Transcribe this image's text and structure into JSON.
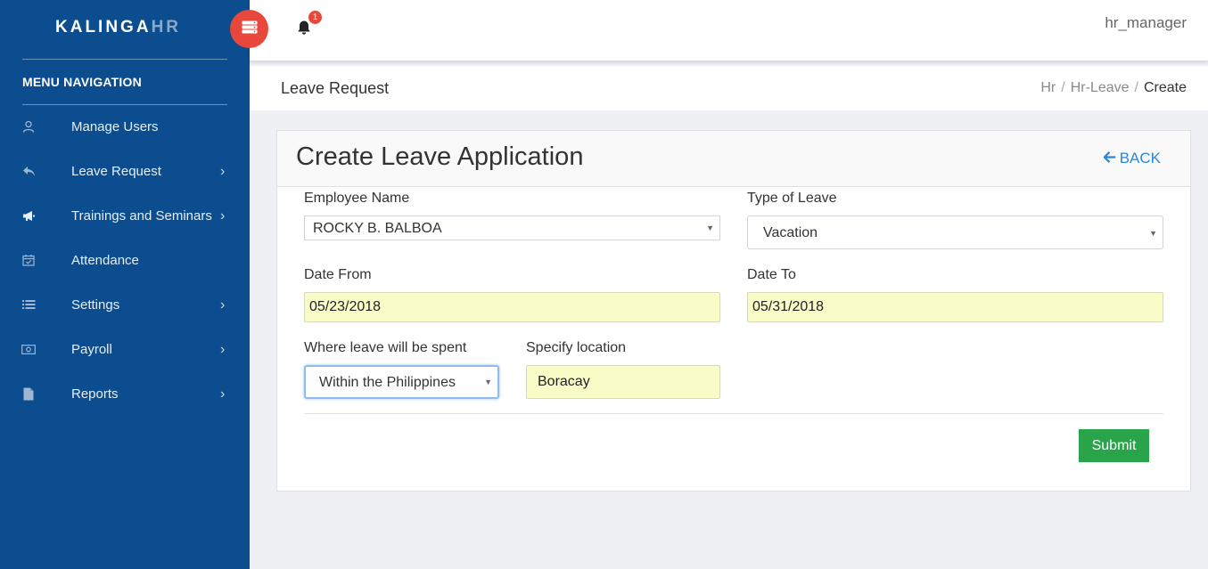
{
  "brand": {
    "name_part1": "KALINGA",
    "name_part2": "HR"
  },
  "topbar": {
    "notification_count": "1",
    "username": "hr_manager"
  },
  "sidebar": {
    "title": "MENU NAVIGATION",
    "items": [
      {
        "label": "Manage Users",
        "icon": "user-icon",
        "has_submenu": false
      },
      {
        "label": "Leave Request",
        "icon": "reply-icon",
        "has_submenu": true
      },
      {
        "label": "Trainings and Seminars",
        "icon": "megaphone-icon",
        "has_submenu": true
      },
      {
        "label": "Attendance",
        "icon": "calendar-check-icon",
        "has_submenu": false
      },
      {
        "label": "Settings",
        "icon": "list-icon",
        "has_submenu": true
      },
      {
        "label": "Payroll",
        "icon": "money-icon",
        "has_submenu": true
      },
      {
        "label": "Reports",
        "icon": "file-icon",
        "has_submenu": true
      }
    ],
    "chevron": "›"
  },
  "page": {
    "title": "Leave Request",
    "breadcrumb": [
      "Hr",
      "Hr-Leave",
      "Create"
    ],
    "breadcrumb_sep": "/"
  },
  "form": {
    "title": "Create Leave Application",
    "back_label": "BACK",
    "employee_name": {
      "label": "Employee Name",
      "value": "ROCKY B. BALBOA"
    },
    "type_of_leave": {
      "label": "Type of Leave",
      "value": "Vacation"
    },
    "date_from": {
      "label": "Date From",
      "value": "05/23/2018"
    },
    "date_to": {
      "label": "Date To",
      "value": "05/31/2018"
    },
    "where_spent": {
      "label": "Where leave will be spent",
      "value": "Within the Philippines"
    },
    "location": {
      "label": "Specify location",
      "value": "Boracay"
    },
    "submit_label": "Submit"
  },
  "colors": {
    "sidebar_bg": "#0b4d8f",
    "accent_red": "#e8483b",
    "link_blue": "#2a86d8",
    "submit_green": "#2aa44a",
    "autofill_yellow": "#fafcc8"
  }
}
